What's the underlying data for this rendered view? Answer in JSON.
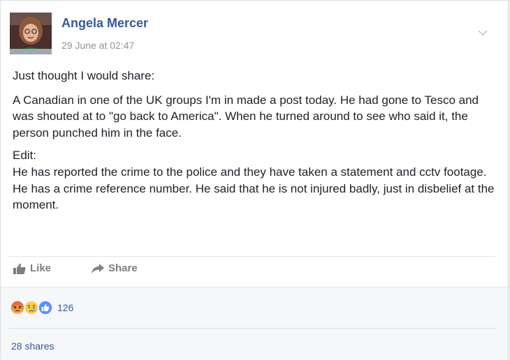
{
  "post": {
    "author": "Angela Mercer",
    "timestamp": "29 June at 02:47",
    "body": {
      "intro": "Just thought I would share:",
      "story": "A Canadian in one of the UK groups I'm in made a post today. He had gone to Tesco and was shouted at to \"go back to America\". When he turned around to see who said it, the person punched him in the face.",
      "edit_label": "Edit:",
      "edit_text": "He has reported the crime to the police and they have taken a statement and cctv footage. He has a crime reference number. He said that he is not injured badly, just in disbelief at the moment."
    }
  },
  "actions": {
    "like_label": "Like",
    "share_label": "Share",
    "like_icon": "thumbs-up-icon",
    "share_icon": "share-arrow-icon"
  },
  "reactions": {
    "icons": [
      "angry-reaction-icon",
      "sad-reaction-icon",
      "like-reaction-icon"
    ],
    "count": "126"
  },
  "shares_text": "28 shares",
  "colors": {
    "link": "#365899",
    "meta": "#90949c",
    "body": "#1d2129",
    "action": "#7f7f7f"
  }
}
